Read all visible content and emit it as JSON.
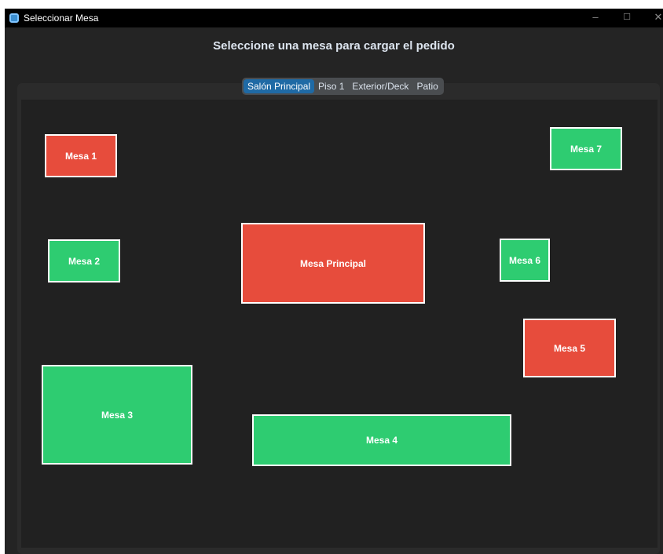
{
  "window": {
    "title": "Seleccionar Mesa",
    "minimize_glyph": "–",
    "maximize_glyph": "☐",
    "close_glyph": "✕"
  },
  "heading": "Seleccione una mesa para cargar el pedido",
  "tabs": [
    {
      "label": "Salón Principal",
      "selected": true
    },
    {
      "label": "Piso 1",
      "selected": false
    },
    {
      "label": "Exterior/Deck",
      "selected": false
    },
    {
      "label": "Patio",
      "selected": false
    }
  ],
  "colors": {
    "occupied": "#e74c3c",
    "free": "#2ecc71",
    "tab_active": "#1f6aa5"
  },
  "tables": [
    {
      "label": "Mesa 1",
      "status": "occupied"
    },
    {
      "label": "Mesa 7",
      "status": "free"
    },
    {
      "label": "Mesa 2",
      "status": "free"
    },
    {
      "label": "Mesa Principal",
      "status": "occupied"
    },
    {
      "label": "Mesa 6",
      "status": "free"
    },
    {
      "label": "Mesa 5",
      "status": "occupied"
    },
    {
      "label": "Mesa 3",
      "status": "free"
    },
    {
      "label": "Mesa 4",
      "status": "free"
    }
  ]
}
